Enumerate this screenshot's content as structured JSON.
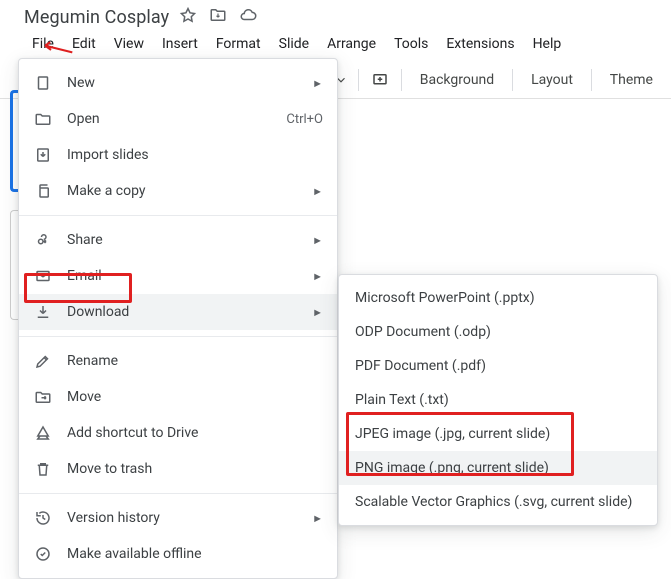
{
  "doc": {
    "title": "Megumin Cosplay"
  },
  "menubar": {
    "file": "File",
    "edit": "Edit",
    "view": "View",
    "insert": "Insert",
    "format": "Format",
    "slide": "Slide",
    "arrange": "Arrange",
    "tools": "Tools",
    "extensions": "Extensions",
    "help": "Help"
  },
  "toolbar": {
    "background": "Background",
    "layout": "Layout",
    "theme": "Theme"
  },
  "file_menu": {
    "new": "New",
    "open": "Open",
    "open_shortcut": "Ctrl+O",
    "import_slides": "Import slides",
    "make_a_copy": "Make a copy",
    "share": "Share",
    "email": "Email",
    "download": "Download",
    "rename": "Rename",
    "move": "Move",
    "add_shortcut": "Add shortcut to Drive",
    "move_to_trash": "Move to trash",
    "version_history": "Version history",
    "make_available_offline": "Make available offline"
  },
  "download_submenu": {
    "pptx": "Microsoft PowerPoint (.pptx)",
    "odp": "ODP Document (.odp)",
    "pdf": "PDF Document (.pdf)",
    "txt": "Plain Text (.txt)",
    "jpg": "JPEG image (.jpg, current slide)",
    "png": "PNG image (.png, current slide)",
    "svg": "Scalable Vector Graphics (.svg, current slide)"
  }
}
